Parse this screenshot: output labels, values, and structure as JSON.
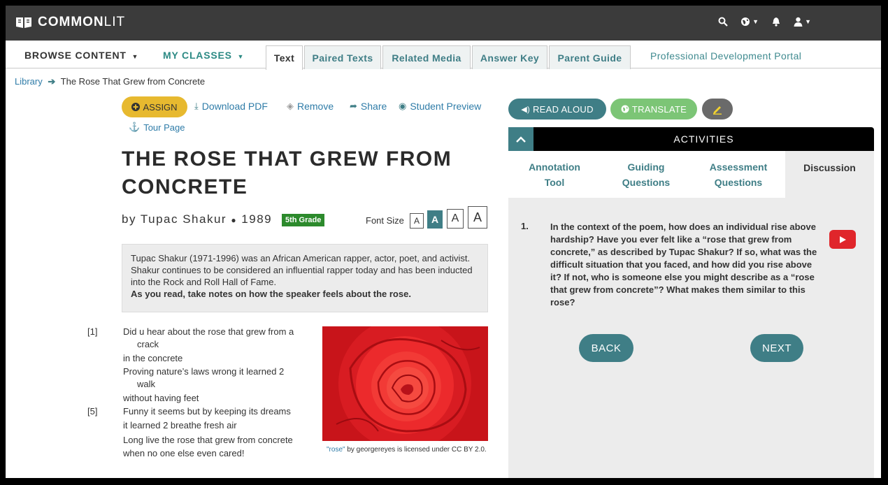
{
  "header": {
    "brand_bold": "COMMON",
    "brand_light": "LIT",
    "icons": [
      "search-icon",
      "globe-icon",
      "bell-icon",
      "user-icon"
    ]
  },
  "nav": {
    "browse": "BROWSE CONTENT",
    "my_classes": "MY CLASSES",
    "tabs": [
      "Text",
      "Paired Texts",
      "Related Media",
      "Answer Key",
      "Parent Guide"
    ],
    "active_tab": "Text",
    "pd_portal": "Professional Development Portal"
  },
  "breadcrumb": {
    "library": "Library",
    "current": "The Rose That Grew from Concrete"
  },
  "actions": {
    "assign": "ASSIGN",
    "download": "Download PDF",
    "remove": "Remove",
    "share": "Share",
    "student_preview": "Student Preview",
    "tour": "Tour Page"
  },
  "text": {
    "title": "THE ROSE THAT GREW FROM CONCRETE",
    "byline": "by Tupac Shakur",
    "year": "1989",
    "grade": "5th Grade",
    "font_size_label": "Font Size",
    "font_buttons": [
      "A",
      "A",
      "A",
      "A"
    ],
    "intro": "Tupac Shakur (1971-1996) was an African American rapper, actor, poet, and activist. Shakur continues to be considered an influential rapper today and has been inducted into the Rock and Roll Hall of Fame.",
    "intro_bold": "As you read, take notes on how the speaker feels about the rose.",
    "line_numbers": [
      "[1]",
      "[5]"
    ],
    "poem_lines": [
      "Did u hear about the rose that grew from a",
      "crack",
      "in the concrete",
      "Proving nature’s laws wrong it learned 2",
      "walk",
      "without having feet",
      "Funny it seems but by keeping its dreams",
      "it learned 2 breathe fresh air",
      "Long live the rose that grew from concrete",
      "when no one else even cared!"
    ],
    "caption_link": "\"rose\"",
    "caption_rest": " by georgereyes is licensed under CC BY 2.0."
  },
  "right": {
    "read_aloud": "READ ALOUD",
    "translate": "TRANSLATE",
    "activities": "ACTIVITIES",
    "tabs": [
      {
        "line1": "Annotation",
        "line2": "Tool"
      },
      {
        "line1": "Guiding",
        "line2": "Questions"
      },
      {
        "line1": "Assessment",
        "line2": "Questions"
      },
      {
        "line1": "Discussion",
        "line2": ""
      }
    ],
    "question_number": "1.",
    "question": "In the context of the poem, how does an individual rise above hardship? Have you ever felt like a “rose that grew from concrete,” as described by Tupac Shakur? If so, what was the difficult situation that you faced, and how did you rise above it? If not, who is someone else you might describe as a “rose that grew from concrete”? What makes them similar to this rose?",
    "back": "BACK",
    "next": "NEXT"
  },
  "colors": {
    "teal": "#3f7e86",
    "assign_yellow": "#e7b92f",
    "translate_green": "#7cc576",
    "grade_green": "#2c8a2c",
    "youtube_red": "#e0262b"
  }
}
